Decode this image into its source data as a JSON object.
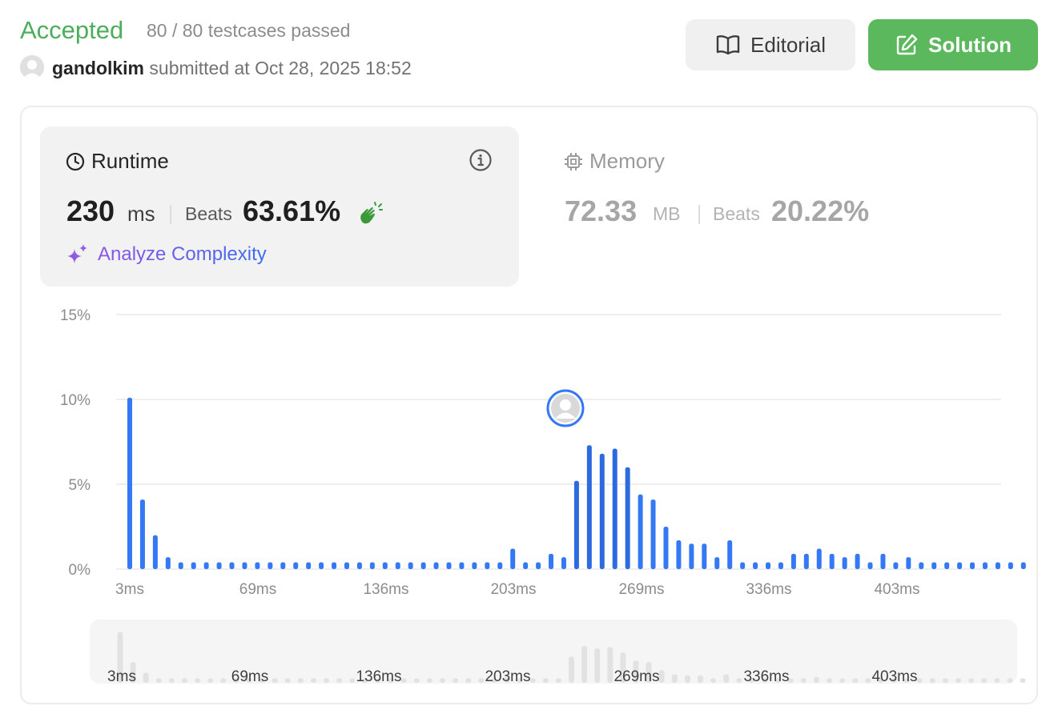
{
  "header": {
    "status": "Accepted",
    "testcases": "80 / 80 testcases passed",
    "author": "gandolkim",
    "submitted_text": "submitted at Oct 28, 2025 18:52"
  },
  "buttons": {
    "editorial": "Editorial",
    "solution": "Solution"
  },
  "runtime": {
    "title": "Runtime",
    "value": "230",
    "unit": "ms",
    "beats_label": "Beats",
    "beats_value": "63.61%",
    "analyze": "Analyze Complexity"
  },
  "memory": {
    "title": "Memory",
    "value": "72.33",
    "unit": "MB",
    "beats_label": "Beats",
    "beats_value": "20.22%"
  },
  "colors": {
    "accepted": "#4cae5c",
    "solution_button": "#5cb85c",
    "bar": "#3478f6",
    "bar_selected": "#2d6ae0",
    "minimap_bar": "#e2e2e2"
  },
  "chart_data": {
    "type": "bar",
    "yticks": [
      "15%",
      "10%",
      "5%",
      "0%"
    ],
    "ylim": [
      0,
      15
    ],
    "xticks": [
      "3ms",
      "69ms",
      "136ms",
      "203ms",
      "269ms",
      "336ms",
      "403ms"
    ],
    "selected_index": 34,
    "values": [
      10.1,
      4.1,
      2.0,
      0.7,
      0.4,
      0.4,
      0.4,
      0.4,
      0.4,
      0.4,
      0.4,
      0.4,
      0.4,
      0.4,
      0.4,
      0.4,
      0.4,
      0.4,
      0.4,
      0.4,
      0.4,
      0.4,
      0.4,
      0.4,
      0.4,
      0.4,
      0.4,
      0.4,
      0.4,
      0.4,
      1.2,
      0.4,
      0.4,
      0.9,
      0.7,
      5.2,
      7.3,
      6.8,
      7.1,
      6.0,
      4.4,
      4.1,
      2.5,
      1.7,
      1.5,
      1.5,
      0.7,
      1.7,
      0.4,
      0.4,
      0.4,
      0.4,
      0.9,
      0.9,
      1.2,
      0.9,
      0.7,
      0.9,
      0.4,
      0.9,
      0.4,
      0.7,
      0.4,
      0.4,
      0.4,
      0.4,
      0.4,
      0.4,
      0.4,
      0.4,
      0.4
    ]
  }
}
